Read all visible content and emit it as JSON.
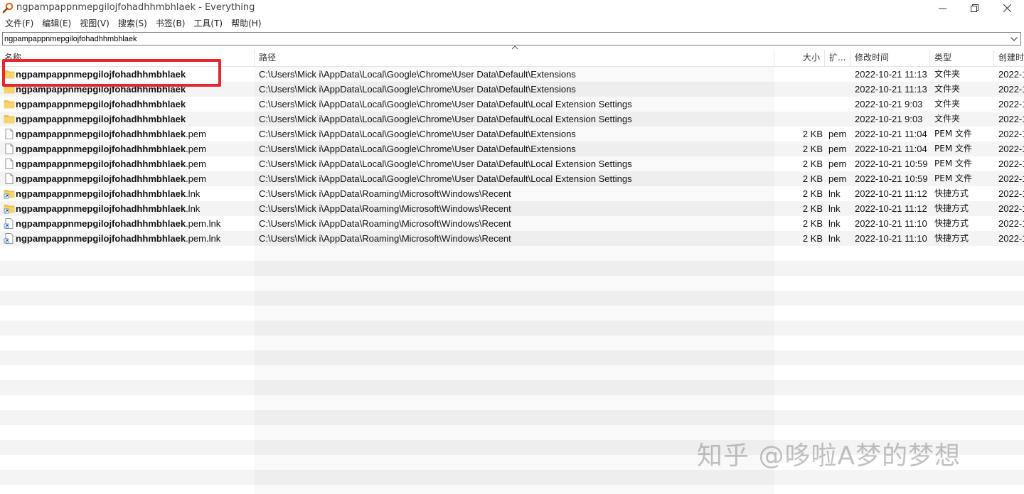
{
  "window": {
    "title": "ngpampappnmepgilojfohadhhmbhlaek - Everything",
    "controls": {
      "minimize": "—",
      "maximize": "❐",
      "close": "✕"
    }
  },
  "menu": [
    "文件(F)",
    "编辑(E)",
    "视图(V)",
    "搜索(S)",
    "书签(B)",
    "工具(T)",
    "帮助(H)"
  ],
  "search": {
    "value": "ngpampappnmepgilojfohadhhmbhlaek"
  },
  "columns": {
    "name": "名称",
    "path": "路径",
    "size": "大小",
    "ext": "扩...",
    "modified": "修改时间",
    "type": "类型",
    "created": "创建时"
  },
  "rows": [
    {
      "icon": "folder-icon",
      "name": "ngpampappnmepgilojfohadhhmbhlaek",
      "ext_suffix": "",
      "path": "C:\\Users\\Mick i\\AppData\\Local\\Google\\Chrome\\User Data\\Default\\Extensions",
      "size": "",
      "ext": "",
      "modified": "2022-10-21 11:13",
      "type": "文件夹",
      "created": "2022-1"
    },
    {
      "icon": "folder-icon",
      "name": "ngpampappnmepgilojfohadhhmbhlaek",
      "ext_suffix": "",
      "path": "C:\\Users\\Mick i\\AppData\\Local\\Google\\Chrome\\User Data\\Default\\Extensions",
      "size": "",
      "ext": "",
      "modified": "2022-10-21 11:13",
      "type": "文件夹",
      "created": "2022-1"
    },
    {
      "icon": "folder-icon",
      "name": "ngpampappnmepgilojfohadhhmbhlaek",
      "ext_suffix": "",
      "path": "C:\\Users\\Mick i\\AppData\\Local\\Google\\Chrome\\User Data\\Default\\Local Extension Settings",
      "size": "",
      "ext": "",
      "modified": "2022-10-21 9:03",
      "type": "文件夹",
      "created": "2022-1"
    },
    {
      "icon": "folder-icon",
      "name": "ngpampappnmepgilojfohadhhmbhlaek",
      "ext_suffix": "",
      "path": "C:\\Users\\Mick i\\AppData\\Local\\Google\\Chrome\\User Data\\Default\\Local Extension Settings",
      "size": "",
      "ext": "",
      "modified": "2022-10-21 9:03",
      "type": "文件夹",
      "created": "2022-1"
    },
    {
      "icon": "file-icon",
      "name": "ngpampappnmepgilojfohadhhmbhlaek",
      "ext_suffix": ".pem",
      "path": "C:\\Users\\Mick i\\AppData\\Local\\Google\\Chrome\\User Data\\Default\\Extensions",
      "size": "2 KB",
      "ext": "pem",
      "modified": "2022-10-21 11:04",
      "type": "PEM 文件",
      "created": "2022-1"
    },
    {
      "icon": "file-icon",
      "name": "ngpampappnmepgilojfohadhhmbhlaek",
      "ext_suffix": ".pem",
      "path": "C:\\Users\\Mick i\\AppData\\Local\\Google\\Chrome\\User Data\\Default\\Extensions",
      "size": "2 KB",
      "ext": "pem",
      "modified": "2022-10-21 11:04",
      "type": "PEM 文件",
      "created": "2022-1"
    },
    {
      "icon": "file-icon",
      "name": "ngpampappnmepgilojfohadhhmbhlaek",
      "ext_suffix": ".pem",
      "path": "C:\\Users\\Mick i\\AppData\\Local\\Google\\Chrome\\User Data\\Default\\Local Extension Settings",
      "size": "2 KB",
      "ext": "pem",
      "modified": "2022-10-21 10:59",
      "type": "PEM 文件",
      "created": "2022-1"
    },
    {
      "icon": "file-icon",
      "name": "ngpampappnmepgilojfohadhhmbhlaek",
      "ext_suffix": ".pem",
      "path": "C:\\Users\\Mick i\\AppData\\Local\\Google\\Chrome\\User Data\\Default\\Local Extension Settings",
      "size": "2 KB",
      "ext": "pem",
      "modified": "2022-10-21 10:59",
      "type": "PEM 文件",
      "created": "2022-1"
    },
    {
      "icon": "folder-shortcut-icon",
      "name": "ngpampappnmepgilojfohadhhmbhlaek",
      "ext_suffix": ".lnk",
      "path": "C:\\Users\\Mick i\\AppData\\Roaming\\Microsoft\\Windows\\Recent",
      "size": "2 KB",
      "ext": "lnk",
      "modified": "2022-10-21 11:12",
      "type": "快捷方式",
      "created": "2022-1"
    },
    {
      "icon": "folder-shortcut-icon",
      "name": "ngpampappnmepgilojfohadhhmbhlaek",
      "ext_suffix": ".lnk",
      "path": "C:\\Users\\Mick i\\AppData\\Roaming\\Microsoft\\Windows\\Recent",
      "size": "2 KB",
      "ext": "lnk",
      "modified": "2022-10-21 11:12",
      "type": "快捷方式",
      "created": "2022-1"
    },
    {
      "icon": "file-shortcut-icon",
      "name": "ngpampappnmepgilojfohadhhmbhlaek",
      "ext_suffix": ".pem.lnk",
      "path": "C:\\Users\\Mick i\\AppData\\Roaming\\Microsoft\\Windows\\Recent",
      "size": "2 KB",
      "ext": "lnk",
      "modified": "2022-10-21 11:10",
      "type": "快捷方式",
      "created": "2022-1"
    },
    {
      "icon": "file-shortcut-icon",
      "name": "ngpampappnmepgilojfohadhhmbhlaek",
      "ext_suffix": ".pem.lnk",
      "path": "C:\\Users\\Mick i\\AppData\\Roaming\\Microsoft\\Windows\\Recent",
      "size": "2 KB",
      "ext": "lnk",
      "modified": "2022-10-21 11:10",
      "type": "快捷方式",
      "created": "2022-1"
    }
  ],
  "watermark": "知乎 @哆啦A梦的梦想",
  "colors": {
    "highlight": "#e3262f",
    "folder": "#f3c443",
    "stripe": "#f4f4f4"
  }
}
